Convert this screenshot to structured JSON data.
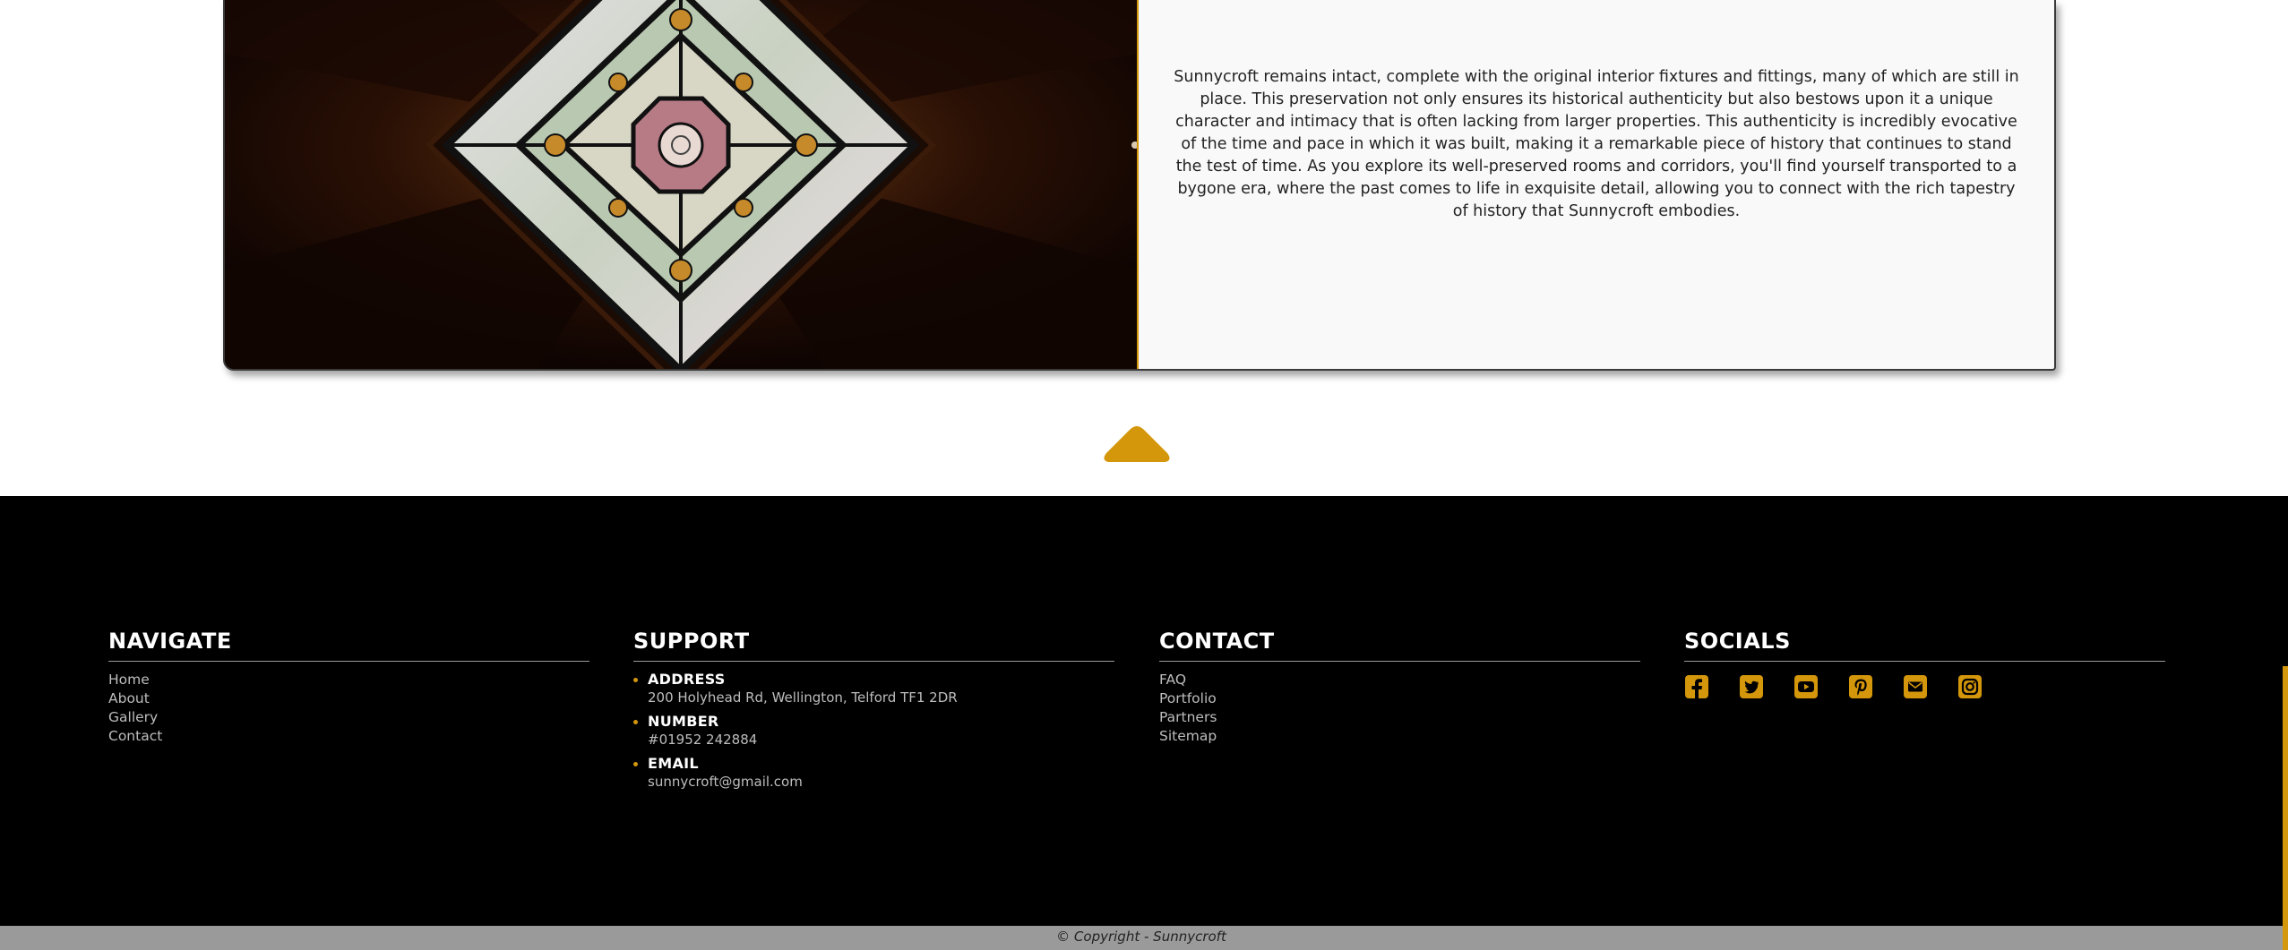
{
  "intro": {
    "paragraph": "Sunnycroft remains intact, complete with the original interior fixtures and fittings, many of which are still in place. This preservation not only ensures its historical authenticity but also bestows upon it a unique character and intimacy that is often lacking from larger properties. This authenticity is incredibly evocative of the time and pace in which it was built, making it a remarkable piece of history that continues to stand the test of time. As you explore its well-preserved rooms and corridors, you'll find yourself transported to a bygone era, where the past comes to life in exquisite detail, allowing you to connect with the rich tapestry of history that Sunnycroft embodies."
  },
  "colors": {
    "accent": "#d4960a",
    "footer_bg": "#000000",
    "copyright_bg": "#9a9a9a"
  },
  "footer": {
    "navigate": {
      "title": "NAVIGATE",
      "links": [
        "Home",
        "About",
        "Gallery",
        "Contact"
      ]
    },
    "support": {
      "title": "SUPPORT",
      "items": [
        {
          "label": "ADDRESS",
          "value": "200 Holyhead Rd, Wellington, Telford TF1 2DR"
        },
        {
          "label": "NUMBER",
          "value": "#01952 242884"
        },
        {
          "label": "EMAIL",
          "value": "sunnycroft@gmail.com"
        }
      ]
    },
    "contact": {
      "title": "CONTACT",
      "links": [
        "FAQ",
        "Portfolio",
        "Partners",
        "Sitemap"
      ]
    },
    "socials": {
      "title": "SOCIALS",
      "icons": [
        "facebook-icon",
        "twitter-icon",
        "youtube-icon",
        "pinterest-icon",
        "email-icon",
        "instagram-icon"
      ]
    }
  },
  "copyright": "© Copyright - Sunnycroft"
}
